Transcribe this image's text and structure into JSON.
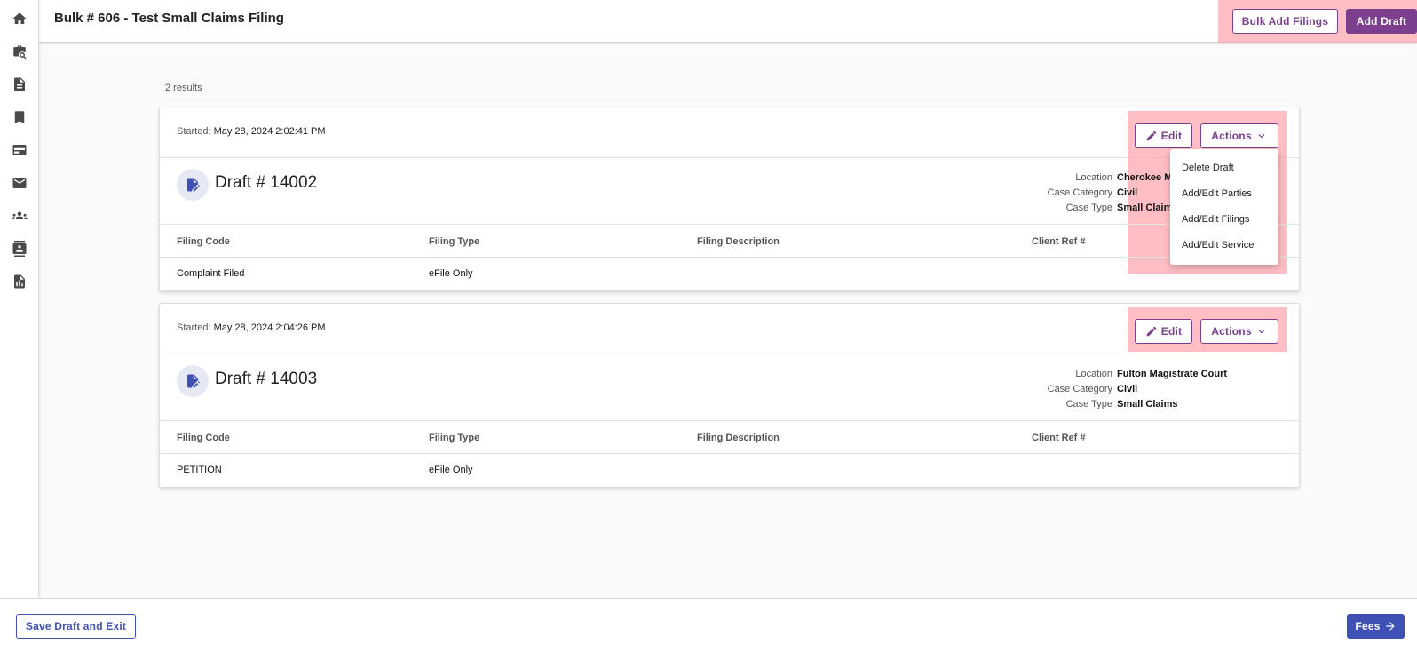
{
  "sidebar": {
    "items": [
      {
        "icon": "home-icon"
      },
      {
        "icon": "case-search-icon"
      },
      {
        "icon": "document-icon"
      },
      {
        "icon": "bookmark-icon"
      },
      {
        "icon": "card-icon"
      },
      {
        "icon": "mail-icon"
      },
      {
        "icon": "people-icon"
      },
      {
        "icon": "contact-icon"
      },
      {
        "icon": "report-icon"
      }
    ]
  },
  "header": {
    "title": "Bulk # 606 - Test Small Claims Filing",
    "bulk_add_label": "Bulk Add Filings",
    "add_draft_label": "Add Draft"
  },
  "results_text": "2 results",
  "drafts": [
    {
      "started_label": "Started:",
      "started_value": "May 28, 2024 2:02:41 PM",
      "edit_label": "Edit",
      "actions_label": "Actions",
      "title": "Draft # 14002",
      "meta_labels": {
        "location": "Location",
        "case_category": "Case Category",
        "case_type": "Case Type"
      },
      "meta_values": {
        "location": "Cherokee Ma",
        "case_category": "Civil",
        "case_type": "Small Claims"
      },
      "columns": {
        "filing_code": "Filing Code",
        "filing_type": "Filing Type",
        "filing_description": "Filing Description",
        "client_ref": "Client Ref #"
      },
      "row": {
        "filing_code": "Complaint Filed",
        "filing_type": "eFile Only",
        "filing_description": "",
        "client_ref": ""
      }
    },
    {
      "started_label": "Started:",
      "started_value": "May 28, 2024 2:04:26 PM",
      "edit_label": "Edit",
      "actions_label": "Actions",
      "title": "Draft # 14003",
      "meta_labels": {
        "location": "Location",
        "case_category": "Case Category",
        "case_type": "Case Type"
      },
      "meta_values": {
        "location": "Fulton Magistrate Court",
        "case_category": "Civil",
        "case_type": "Small Claims"
      },
      "columns": {
        "filing_code": "Filing Code",
        "filing_type": "Filing Type",
        "filing_description": "Filing Description",
        "client_ref": "Client Ref #"
      },
      "row": {
        "filing_code": "PETITION",
        "filing_type": "eFile Only",
        "filing_description": "",
        "client_ref": ""
      }
    }
  ],
  "actions_menu": {
    "items": [
      "Delete Draft",
      "Add/Edit Parties",
      "Add/Edit Filings",
      "Add/Edit Service"
    ]
  },
  "footer": {
    "save_exit_label": "Save Draft and Exit",
    "fees_label": "Fees"
  },
  "colors": {
    "accent_purple": "#7b3f8e",
    "accent_blue": "#3f51b5",
    "highlight": "#ffa0aa"
  }
}
